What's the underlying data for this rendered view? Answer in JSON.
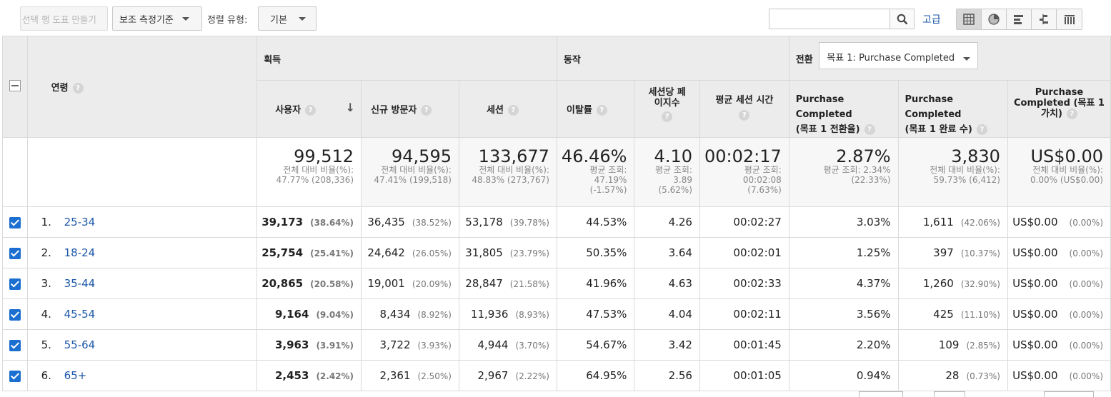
{
  "toolbar": {
    "make_chart": "선택 행 도표 만들기",
    "secondary_dim": "보조 측정기준",
    "sort_label": "정렬 유형:",
    "sort_value": "기본",
    "search_value": "",
    "advanced": "고급"
  },
  "icons": {
    "search": "search-icon",
    "views": [
      "table-view-icon",
      "pie-view-icon",
      "performance-view-icon",
      "comparison-view-icon",
      "pivot-view-icon"
    ]
  },
  "groups": {
    "dimension": "연령",
    "acquisition": "획득",
    "behavior": "동작",
    "conversion": "전환",
    "goal_select": "목표 1: Purchase Completed"
  },
  "columns": {
    "users": "사용자",
    "new_users": "신규 방문자",
    "sessions": "세션",
    "bounce": "이탈률",
    "pages_line1": "세션당 페",
    "pages_line2": "이지수",
    "avg_time": "평균 세션 시간",
    "conv_rate_line1": "Purchase Completed",
    "conv_rate_line2": "(목표 1 전환율)",
    "completions_line1": "Purchase Completed",
    "completions_line2": "(목표 1 완료 수)",
    "value_line1": "Purchase",
    "value_line2": "Completed (목표 1",
    "value_line3": "가치)"
  },
  "totals": {
    "users": {
      "big": "99,512",
      "l1": "전체 대비 비율(%):",
      "l2": "47.77% (208,336)"
    },
    "new_users": {
      "big": "94,595",
      "l1": "전체 대비 비율(%):",
      "l2": "47.41% (199,518)"
    },
    "sessions": {
      "big": "133,677",
      "l1": "전체 대비 비율(%):",
      "l2": "48.83% (273,767)"
    },
    "bounce": {
      "big": "46.46%",
      "l1": "평균 조회:",
      "l2": "47.19%",
      "l3": "(-1.57%)"
    },
    "pages": {
      "big": "4.10",
      "l1": "평균 조회:",
      "l2": "3.89",
      "l3": "(5.62%)"
    },
    "avg_time": {
      "big": "00:02:17",
      "l1": "평균 조회:",
      "l2": "00:02:08",
      "l3": "(7.63%)"
    },
    "conv_rate": {
      "big": "2.87%",
      "l1": "평균 조회: 2.34%",
      "l2": "(22.33%)"
    },
    "completions": {
      "big": "3,830",
      "l1": "전체 대비 비율(%):",
      "l2": "59.73% (6,412)"
    },
    "value": {
      "big": "US$0.00",
      "l1": "전체 대비 비율(%):",
      "l2": "0.00% (US$0.00)"
    }
  },
  "rows": [
    {
      "num": "1.",
      "age": "25-34",
      "users": "39,173",
      "users_pct": "(38.64%)",
      "new": "36,435",
      "new_pct": "(38.52%)",
      "sessions": "53,178",
      "sessions_pct": "(39.78%)",
      "bounce": "44.53%",
      "pages": "4.26",
      "time": "00:02:27",
      "conv": "3.03%",
      "comp": "1,611",
      "comp_pct": "(42.06%)",
      "value": "US$0.00",
      "value_pct": "(0.00%)"
    },
    {
      "num": "2.",
      "age": "18-24",
      "users": "25,754",
      "users_pct": "(25.41%)",
      "new": "24,642",
      "new_pct": "(26.05%)",
      "sessions": "31,805",
      "sessions_pct": "(23.79%)",
      "bounce": "50.35%",
      "pages": "3.64",
      "time": "00:02:01",
      "conv": "1.25%",
      "comp": "397",
      "comp_pct": "(10.37%)",
      "value": "US$0.00",
      "value_pct": "(0.00%)"
    },
    {
      "num": "3.",
      "age": "35-44",
      "users": "20,865",
      "users_pct": "(20.58%)",
      "new": "19,001",
      "new_pct": "(20.09%)",
      "sessions": "28,847",
      "sessions_pct": "(21.58%)",
      "bounce": "41.96%",
      "pages": "4.63",
      "time": "00:02:33",
      "conv": "4.37%",
      "comp": "1,260",
      "comp_pct": "(32.90%)",
      "value": "US$0.00",
      "value_pct": "(0.00%)"
    },
    {
      "num": "4.",
      "age": "45-54",
      "users": "9,164",
      "users_pct": "(9.04%)",
      "new": "8,434",
      "new_pct": "(8.92%)",
      "sessions": "11,936",
      "sessions_pct": "(8.93%)",
      "bounce": "47.53%",
      "pages": "4.04",
      "time": "00:02:11",
      "conv": "3.56%",
      "comp": "425",
      "comp_pct": "(11.10%)",
      "value": "US$0.00",
      "value_pct": "(0.00%)"
    },
    {
      "num": "5.",
      "age": "55-64",
      "users": "3,963",
      "users_pct": "(3.91%)",
      "new": "3,722",
      "new_pct": "(3.93%)",
      "sessions": "4,944",
      "sessions_pct": "(3.70%)",
      "bounce": "54.67%",
      "pages": "3.42",
      "time": "00:01:45",
      "conv": "2.20%",
      "comp": "109",
      "comp_pct": "(2.85%)",
      "value": "US$0.00",
      "value_pct": "(0.00%)"
    },
    {
      "num": "6.",
      "age": "65+",
      "users": "2,453",
      "users_pct": "(2.42%)",
      "new": "2,361",
      "new_pct": "(2.50%)",
      "sessions": "2,967",
      "sessions_pct": "(2.22%)",
      "bounce": "64.95%",
      "pages": "2.56",
      "time": "00:01:05",
      "conv": "0.94%",
      "comp": "28",
      "comp_pct": "(0.73%)",
      "value": "US$0.00",
      "value_pct": "(0.00%)"
    }
  ]
}
